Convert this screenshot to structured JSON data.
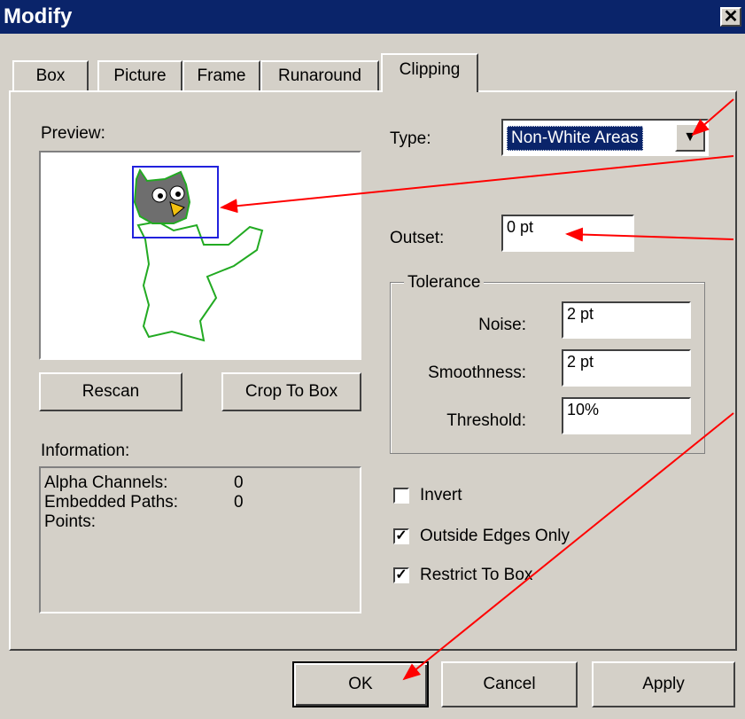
{
  "window": {
    "title": "Modify",
    "close_label": "✕"
  },
  "tabs": [
    {
      "label": "Box",
      "active": false
    },
    {
      "label": "Picture",
      "active": false
    },
    {
      "label": "Frame",
      "active": false
    },
    {
      "label": "Runaround",
      "active": false
    },
    {
      "label": "Clipping",
      "active": true
    }
  ],
  "preview": {
    "label": "Preview:"
  },
  "type": {
    "label": "Type:",
    "value": "Non-White Areas"
  },
  "outset": {
    "label": "Outset:",
    "value": "0 pt"
  },
  "tolerance": {
    "legend": "Tolerance",
    "noise_label": "Noise:",
    "noise_value": "2 pt",
    "smoothness_label": "Smoothness:",
    "smoothness_value": "2 pt",
    "threshold_label": "Threshold:",
    "threshold_value": "10%"
  },
  "buttons": {
    "rescan": "Rescan",
    "crop_to_box": "Crop To Box",
    "ok": "OK",
    "cancel": "Cancel",
    "apply": "Apply"
  },
  "information": {
    "label": "Information:",
    "rows": [
      {
        "name": "Alpha Channels:",
        "value": "0"
      },
      {
        "name": "Embedded Paths:",
        "value": "0"
      },
      {
        "name": "Points:",
        "value": ""
      }
    ]
  },
  "options": {
    "invert": {
      "label": "Invert",
      "checked": false
    },
    "outside_edges_only": {
      "label": "Outside Edges Only",
      "checked": true
    },
    "restrict_to_box": {
      "label": "Restrict To Box",
      "checked": true
    }
  },
  "colors": {
    "titlebar": "#0a246a",
    "select_highlight": "#0a246a",
    "annotation_arrow": "#ff0000",
    "clip_path": "#22aa22",
    "bounding_box": "#2222dd"
  }
}
